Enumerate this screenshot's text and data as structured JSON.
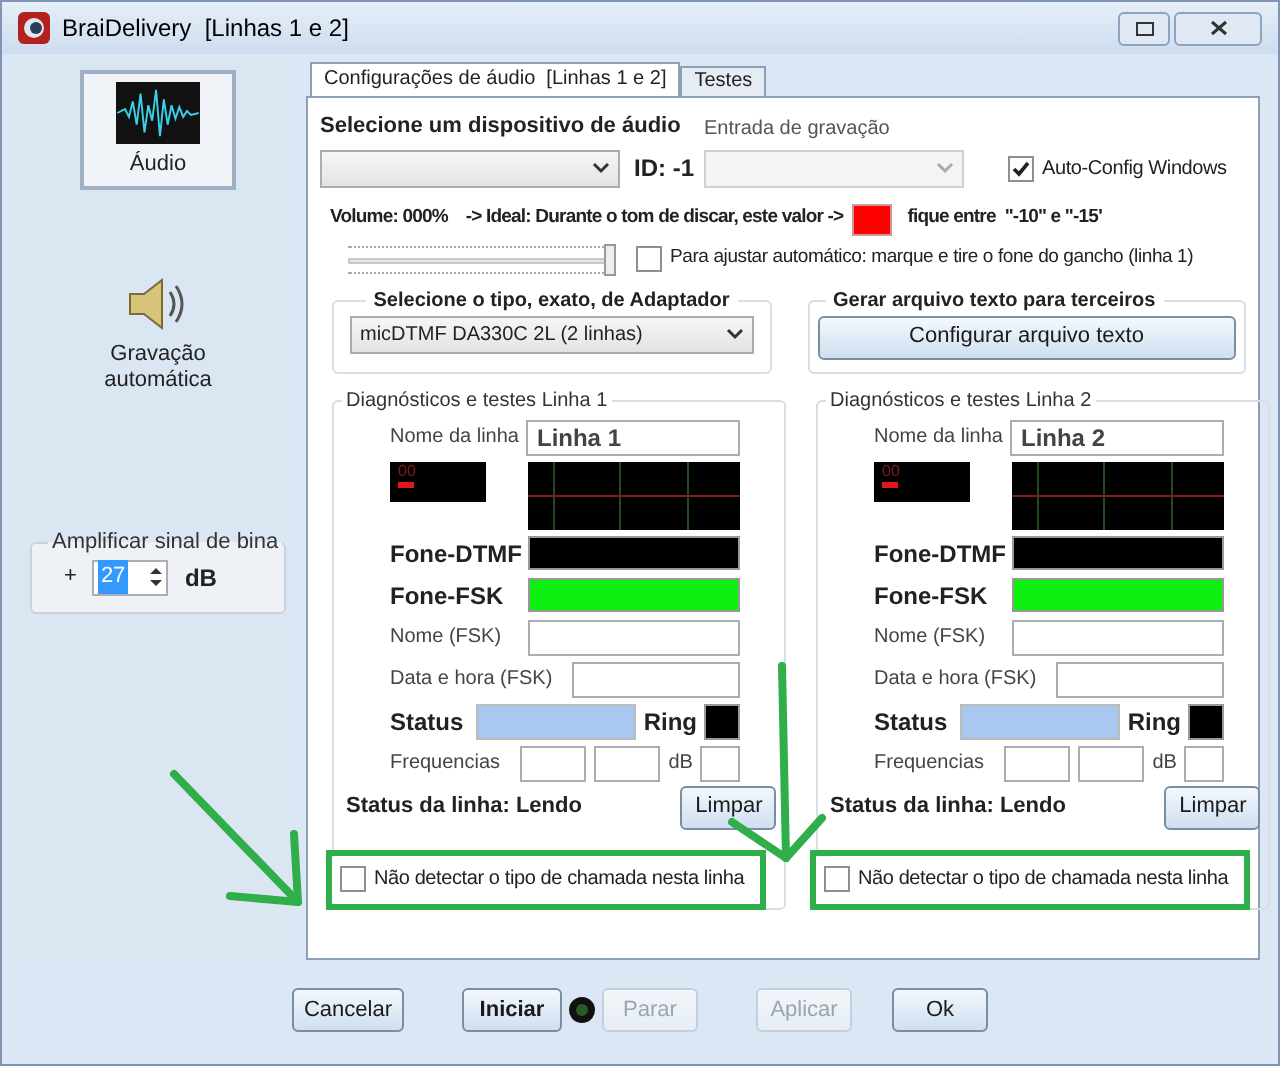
{
  "window": {
    "title": "BraiDelivery  [Linhas 1 e 2]"
  },
  "sidebar": {
    "items": [
      {
        "label": "Áudio",
        "selected": true,
        "kind": "audio"
      },
      {
        "label": "Gravação automática",
        "selected": false,
        "kind": "speaker"
      }
    ],
    "amplify": {
      "title": "Amplificar sinal de bina",
      "prefix": "+",
      "value": "27",
      "unit": "dB"
    }
  },
  "tabs": [
    {
      "label": "Configurações de áudio  [Linhas 1 e 2]",
      "selected": true
    },
    {
      "label": "Testes",
      "selected": false
    }
  ],
  "audio": {
    "device_label": "Selecione um dispositivo de áudio",
    "id_text": "ID: -1",
    "input_label": "Entrada de gravação",
    "auto_config": {
      "label": "Auto-Config Windows",
      "checked": true
    },
    "volume_text": "Volume: 000%    -> Ideal: Durante o tom de discar, este valor ->",
    "volume_hint": "fique entre  \"-10\" e \"-15'",
    "volume_slider": {
      "level": 1
    },
    "auto_adjust": {
      "label": "Para ajustar automático: marque e tire o fone do gancho (linha 1)",
      "checked": false
    }
  },
  "adapter": {
    "title": "Selecione o tipo, exato, de Adaptador",
    "value": "micDTMF DA330C 2L (2 linhas)"
  },
  "export": {
    "title": "Gerar arquivo texto para terceiros",
    "button": "Configurar arquivo texto"
  },
  "lines": [
    {
      "title": "Diagnósticos e testes Linha 1",
      "name_label": "Nome da linha",
      "name_value": "Linha 1",
      "counter": "00",
      "dtmf_label": "Fone-DTMF",
      "dtmf_active": false,
      "fsk_label": "Fone-FSK",
      "fsk_active": true,
      "fsk_name_label": "Nome (FSK)",
      "datetime_label": "Data e hora (FSK)",
      "status_label": "Status",
      "ring_label": "Ring",
      "freq_label": "Frequencias",
      "db_label": "dB",
      "line_status": "Status da linha: Lendo",
      "clear_button": "Limpar",
      "no_detect": {
        "label": "Não detectar o tipo de chamada nesta linha",
        "checked": false
      }
    },
    {
      "title": "Diagnósticos e testes Linha 2",
      "name_label": "Nome da linha",
      "name_value": "Linha 2",
      "counter": "00",
      "dtmf_label": "Fone-DTMF",
      "dtmf_active": false,
      "fsk_label": "Fone-FSK",
      "fsk_active": true,
      "fsk_name_label": "Nome (FSK)",
      "datetime_label": "Data e hora (FSK)",
      "status_label": "Status",
      "ring_label": "Ring",
      "freq_label": "Frequencias",
      "db_label": "dB",
      "line_status": "Status da linha: Lendo",
      "clear_button": "Limpar",
      "no_detect": {
        "label": "Não detectar o tipo de chamada nesta linha",
        "checked": false
      }
    }
  ],
  "buttons": [
    {
      "label": "Cancelar",
      "disabled": false
    },
    {
      "label": "Iniciar",
      "disabled": false,
      "bold": true
    },
    {
      "label": "Parar",
      "disabled": true
    },
    {
      "label": "Aplicar",
      "disabled": true
    },
    {
      "label": "Ok",
      "disabled": false
    }
  ]
}
